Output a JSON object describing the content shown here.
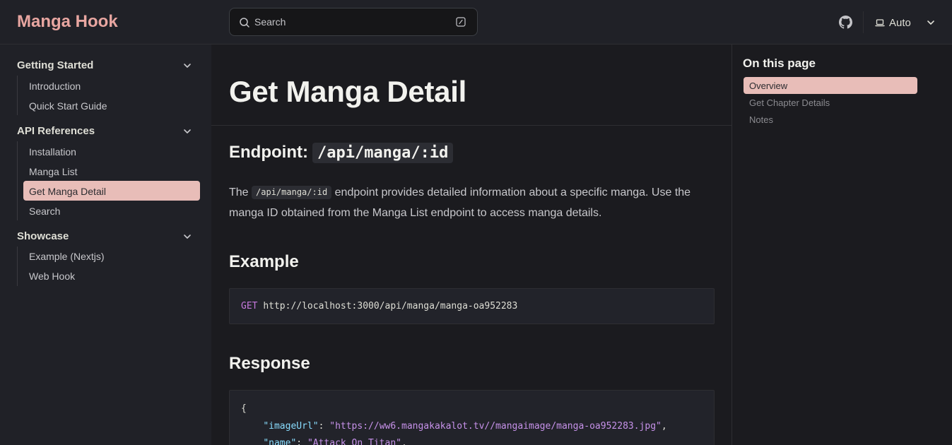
{
  "header": {
    "brand": "Manga Hook",
    "search_placeholder": "Search",
    "theme_label": "Auto"
  },
  "sidebar": {
    "groups": [
      {
        "title": "Getting Started",
        "items": [
          "Introduction",
          "Quick Start Guide"
        ]
      },
      {
        "title": "API References",
        "items": [
          "Installation",
          "Manga List",
          "Get Manga Detail",
          "Search"
        ]
      },
      {
        "title": "Showcase",
        "items": [
          "Example (Nextjs)",
          "Web Hook"
        ]
      }
    ],
    "active_item": "Get Manga Detail"
  },
  "main": {
    "title": "Get Manga Detail",
    "endpoint_heading": "Endpoint:",
    "endpoint_code": "/api/manga/:id",
    "para_before": "The",
    "para_code": "/api/manga/:id",
    "para_after": "endpoint provides detailed information about a specific manga. Use the manga ID obtained from the Manga List endpoint to access manga details.",
    "example_heading": "Example",
    "example_method": "GET",
    "example_url": "http://localhost:3000/api/manga/manga-oa952283",
    "response_heading": "Response",
    "response_open": "{",
    "response_key1": "\"imageUrl\"",
    "response_val1": "\"https://ww6.mangakakalot.tv//mangaimage/manga-oa952283.jpg\"",
    "response_key2": "\"name\"",
    "response_val2": "\"Attack On Titan\""
  },
  "aside": {
    "title": "On this page",
    "items": [
      "Overview",
      "Get Chapter Details",
      "Notes"
    ],
    "active_item": "Overview"
  },
  "colors": {
    "brand": "#e8a6a1",
    "active_bg": "#e8bdb8",
    "page_bg": "#1b1b1f",
    "sidebar_bg": "#202127"
  }
}
